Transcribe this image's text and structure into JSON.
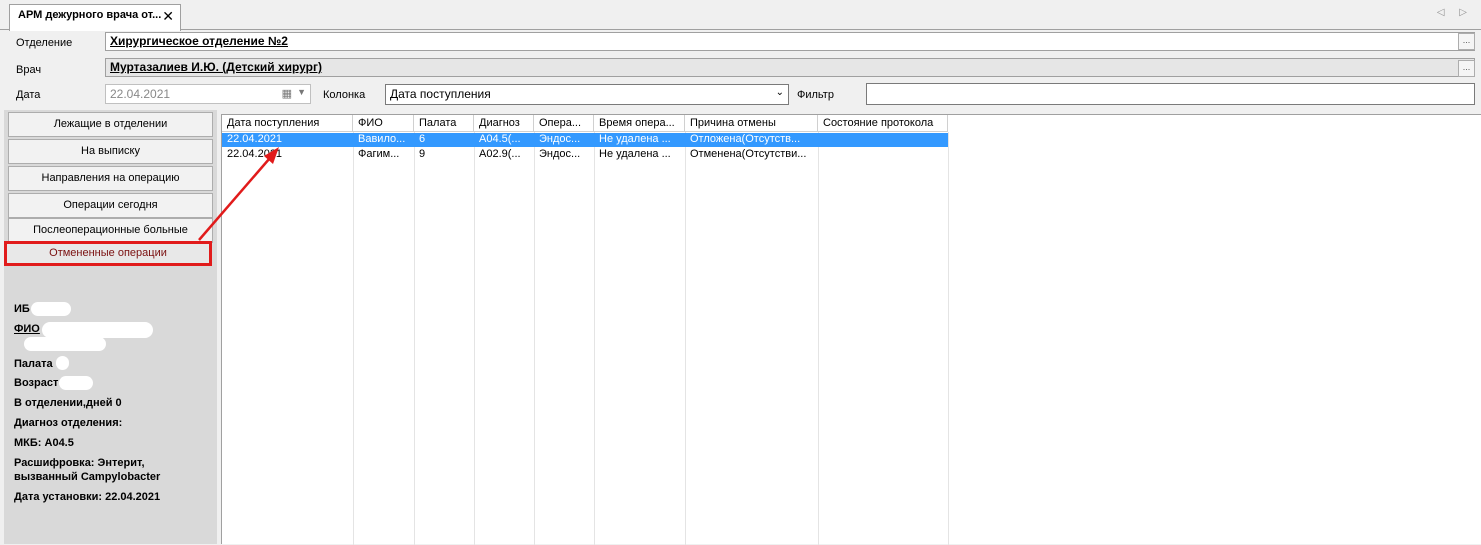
{
  "tab": {
    "title": "АРМ дежурного врача от...",
    "close": "✕"
  },
  "nav_arrows": "◁ ▷",
  "form": {
    "department_label": "Отделение",
    "department_value": "Хирургическое отделение №2",
    "doctor_label": "Врач",
    "doctor_value": "Муртазалиев И.Ю. (Детский хирург)",
    "date_label": "Дата",
    "date_value": "22.04.2021",
    "column_label": "Колонка",
    "column_value": "Дата поступления",
    "filter_label": "Фильтр",
    "filter_value": "",
    "ellipsis": "..."
  },
  "sidebar": {
    "buttons": [
      {
        "label": "Лежащие в отделении"
      },
      {
        "label": "На выписку"
      },
      {
        "label": "Направления на операцию"
      },
      {
        "label": "Операции сегодня"
      },
      {
        "label": "Послеоперационные больные"
      },
      {
        "label": "Отмененные операции",
        "active": true
      }
    ]
  },
  "patient": {
    "ib_label": "ИБ",
    "fio_label": "ФИО",
    "ward_label": "Палата",
    "age_label": "Возраст",
    "days_label": "В отделении,дней 0",
    "dept_diag_label": "Диагноз отделения:",
    "mkb_label": "МКБ: A04.5",
    "decode_line1": "Расшифровка: Энтерит,",
    "decode_line2": "вызванный Campylobacter",
    "set_date_label": "Дата установки: 22.04.2021"
  },
  "grid": {
    "columns": [
      "Дата поступления",
      "ФИО",
      "Палата",
      "Диагноз",
      "Опера...",
      "Время опера...",
      "Причина отмены",
      "Состояние протокола"
    ],
    "rows": [
      [
        "22.04.2021",
        "Вавило...",
        "6",
        "A04.5(...",
        "Эндос...",
        "Не удалена ...",
        "Отложена(Отсутств...",
        ""
      ],
      [
        "22.04.2021",
        "Фагим...",
        "9",
        "A02.9(...",
        "Эндос...",
        "Не удалена ...",
        "Отменена(Отсутстви...",
        ""
      ]
    ],
    "selected_row": 0
  },
  "colors": {
    "selection": "#3399ff",
    "annotation": "#e11b1b"
  }
}
